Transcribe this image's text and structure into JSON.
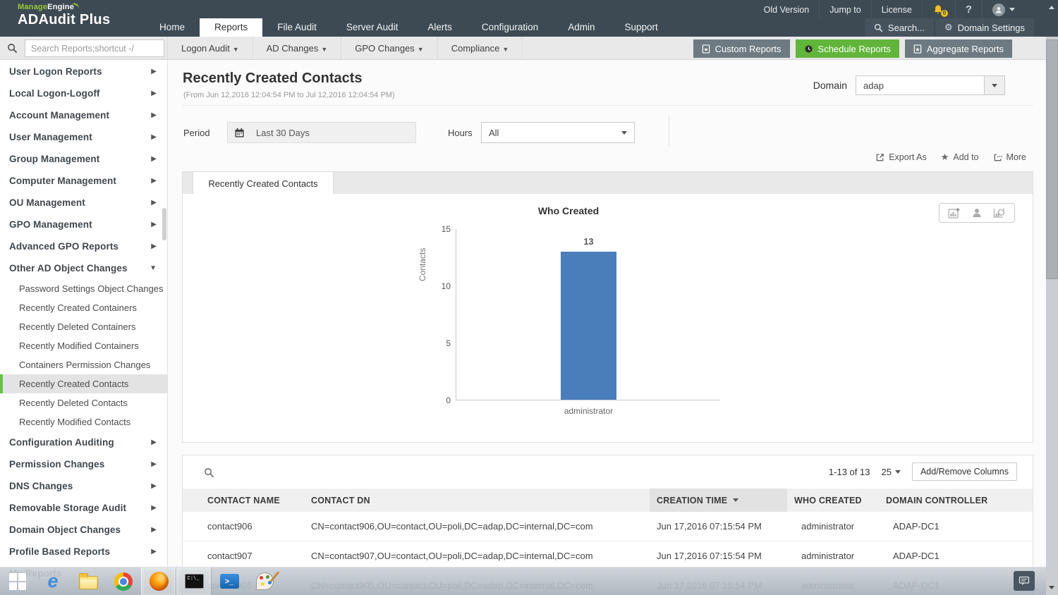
{
  "header": {
    "brand": {
      "manage": "Manage",
      "engine": "Engine",
      "product": "ADAudit Plus"
    },
    "utility": {
      "old_version": "Old Version",
      "jump_to": "Jump to",
      "license": "License",
      "notification_badge": "0"
    },
    "nav": [
      {
        "label": "Home"
      },
      {
        "label": "Reports",
        "active": true
      },
      {
        "label": "File Audit"
      },
      {
        "label": "Server Audit"
      },
      {
        "label": "Alerts"
      },
      {
        "label": "Configuration"
      },
      {
        "label": "Admin"
      },
      {
        "label": "Support"
      }
    ],
    "search_label": "Search...",
    "domain_settings_label": "Domain Settings"
  },
  "toolbar": {
    "search_placeholder": "Search Reports;shortcut -/",
    "menus": [
      "Logon Audit",
      "AD Changes",
      "GPO Changes",
      "Compliance"
    ],
    "custom_reports": "Custom Reports",
    "schedule_reports": "Schedule Reports",
    "aggregate_reports": "Aggregate Reports"
  },
  "sidebar": {
    "items": [
      {
        "label": "User Logon Reports"
      },
      {
        "label": "Local Logon-Logoff"
      },
      {
        "label": "Account Management"
      },
      {
        "label": "User Management"
      },
      {
        "label": "Group Management"
      },
      {
        "label": "Computer Management"
      },
      {
        "label": "OU Management"
      },
      {
        "label": "GPO Management"
      },
      {
        "label": "Advanced GPO Reports"
      },
      {
        "label": "Other AD Object Changes",
        "expanded": true
      },
      {
        "label": "Configuration Auditing"
      },
      {
        "label": "Permission Changes"
      },
      {
        "label": "DNS Changes"
      },
      {
        "label": "Removable Storage Audit"
      },
      {
        "label": "Domain Object Changes"
      },
      {
        "label": "Profile Based Reports"
      },
      {
        "label": "My Reports"
      }
    ],
    "subitems": [
      "Password Settings Object Changes",
      "Recently Created Containers",
      "Recently Deleted Containers",
      "Recently Modified Containers",
      "Containers Permission Changes",
      "Recently Created Contacts",
      "Recently Deleted Contacts",
      "Recently Modified Contacts"
    ],
    "active_subitem": "Recently Created Contacts"
  },
  "report": {
    "title": "Recently Created Contacts",
    "range": "(From Jun 12,2016 12:04:54 PM to Jul 12,2016 12:04:54 PM)",
    "domain_label": "Domain",
    "domain_value": "adap",
    "period_label": "Period",
    "period_value": "Last 30 Days",
    "hours_label": "Hours",
    "hours_value": "All",
    "export_as": "Export As",
    "add_to": "Add to",
    "more": "More",
    "tab": "Recently Created Contacts"
  },
  "chart_data": {
    "type": "bar",
    "title": "Who Created",
    "ylabel": "Contacts",
    "categories": [
      "administrator"
    ],
    "values": [
      13
    ],
    "ylim": [
      0,
      15
    ],
    "yticks": [
      0,
      5,
      10,
      15
    ],
    "grid": false,
    "bar_color": "#4a7eba"
  },
  "table": {
    "pagination": "1-13 of 13",
    "page_size": "25",
    "add_remove_columns": "Add/Remove Columns",
    "columns": [
      "CONTACT NAME",
      "CONTACT DN",
      "CREATION TIME",
      "WHO CREATED",
      "DOMAIN CONTROLLER"
    ],
    "sorted_column": "CREATION TIME",
    "sort_direction": "desc",
    "rows": [
      [
        "contact906",
        "CN=contact906,OU=contact,OU=poli,DC=adap,DC=internal,DC=com",
        "Jun 17,2016 07:15:54 PM",
        "administrator",
        "ADAP-DC1"
      ],
      [
        "contact907",
        "CN=contact907,OU=contact,OU=poli,DC=adap,DC=internal,DC=com",
        "Jun 17,2016 07:15:54 PM",
        "administrator",
        "ADAP-DC1"
      ],
      [
        "contact905",
        "CN=contact905,OU=contact,OU=poli,DC=adap,DC=internal,DC=com",
        "Jun 17,2016 07:15:54 PM",
        "administrator",
        "ADAP-DC1"
      ]
    ]
  },
  "colors": {
    "header_bg": "#3d4a53",
    "accent_green": "#61b53a",
    "sidebar_active_green": "#6abf47",
    "bar_blue": "#4a7eba"
  },
  "taskbar": {
    "icons": [
      "start",
      "internet-explorer",
      "file-explorer",
      "chrome",
      "firefox",
      "cmd",
      "powershell",
      "paint"
    ],
    "open_windows": [
      "firefox",
      "cmd"
    ]
  }
}
